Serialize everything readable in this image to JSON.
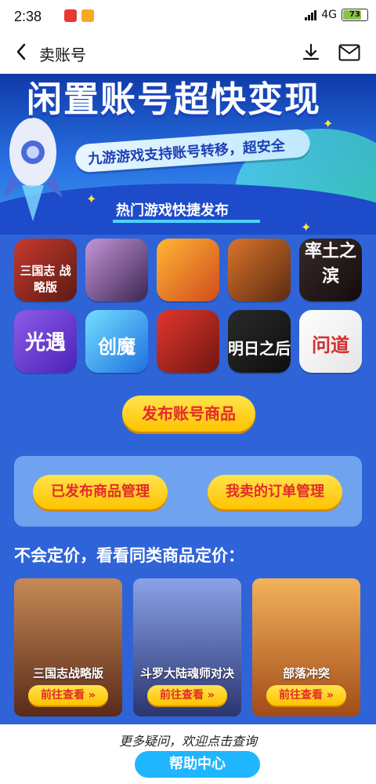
{
  "status_bar": {
    "time": "2:38",
    "network": "4G",
    "battery_percent": "73"
  },
  "navbar": {
    "title": "卖账号",
    "back_icon": "chevron-left-icon",
    "download_icon": "download-icon",
    "mail_icon": "mail-icon"
  },
  "banner": {
    "headline": "闲置账号超快变现",
    "subtitle": "九游游戏支持账号转移，超安全",
    "section_title": "热门游戏快捷发布"
  },
  "apps": [
    [
      {
        "label": "三国志 战略版",
        "color": "#a52a2a"
      },
      {
        "label": "",
        "color": "#7b3fa0"
      },
      {
        "label": "",
        "color": "#f0a22b"
      },
      {
        "label": "",
        "color": "#b95b2a"
      },
      {
        "label": "率土之滨",
        "color": "#2b1f1f"
      }
    ],
    [
      {
        "label": "光遇",
        "color": "#6b3bd6"
      },
      {
        "label": "创魔",
        "color": "#2b9bd8"
      },
      {
        "label": "",
        "color": "#d9342b"
      },
      {
        "label": "明日之后",
        "color": "#1c1c1c"
      },
      {
        "label": "问道",
        "color": "#e9e9e9"
      }
    ]
  ],
  "publish_button": "发布账号商品",
  "manage": {
    "published_label": "已发布商品管理",
    "orders_label": "我卖的订单管理"
  },
  "pricing": {
    "title": "不会定价，看看同类商品定价：",
    "cards": [
      {
        "name": "三国志战略版",
        "button": "前往查看 »",
        "color": "#8b4a2a"
      },
      {
        "name": "斗罗大陆魂师对决",
        "button": "前往查看 »",
        "color": "#4f5f99"
      },
      {
        "name": "部落冲突",
        "button": "前往查看 »",
        "color": "#c7782b"
      }
    ]
  },
  "footer": {
    "text": "更多疑问，欢迎点击查询",
    "help_button": "帮助中心"
  }
}
